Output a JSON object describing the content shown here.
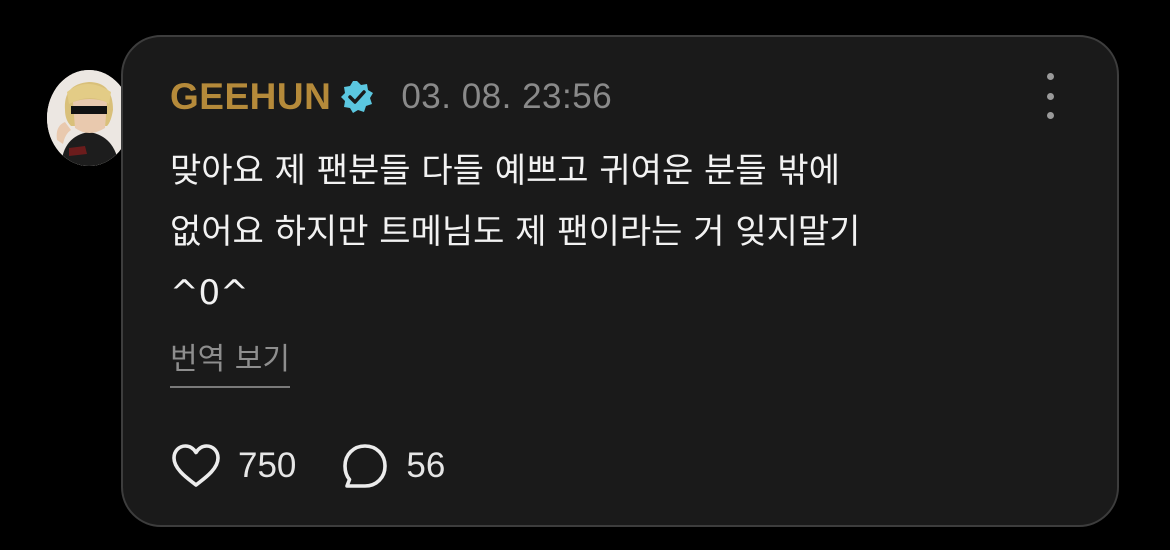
{
  "post": {
    "username": "GEEHUN",
    "timestamp": "03. 08. 23:56",
    "text": "맞아요 제 팬분들 다들 예쁘고 귀여운 분들 밖에\n없어요 하지만 트메님도 제 팬이라는 거 잊지말기\n^0^",
    "translate_label": "번역 보기",
    "likes": "750",
    "comments": "56"
  },
  "icons": {
    "verified": "verified-badge-icon",
    "more": "more-vertical-icon",
    "like": "heart-outline-icon",
    "comment": "speech-bubble-icon"
  },
  "colors": {
    "background": "#000000",
    "card": "#1a1a1a",
    "card_border": "#3d3d3d",
    "username": "#b58a3a",
    "verified": "#5bc7e0",
    "timestamp": "#8a8a8a",
    "text": "#f2f2f2",
    "secondary": "#8e8e8e"
  }
}
